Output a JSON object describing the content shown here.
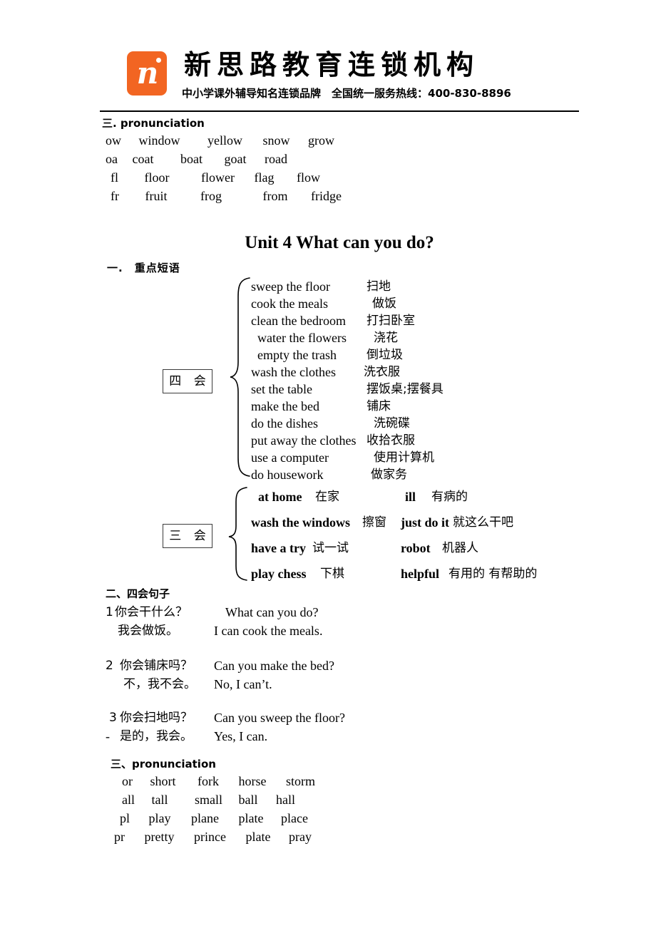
{
  "header": {
    "brand_title": "新思路教育连锁机构",
    "brand_sub": "中小学课外辅导知名连锁品牌　全国统一服务热线：400-830-8896",
    "logo_letter": "n",
    "logo_color": "#F26522"
  },
  "top_pronunciation": {
    "heading": "三. pronunciation",
    "rows": [
      {
        "key": "ow",
        "words": [
          "window",
          "yellow",
          "snow",
          "grow"
        ]
      },
      {
        "key": "oa",
        "words": [
          "coat",
          "boat",
          "goat",
          "road"
        ]
      },
      {
        "key": "fl",
        "words": [
          "floor",
          "flower",
          "flag",
          "flow"
        ]
      },
      {
        "key": "fr",
        "words": [
          "fruit",
          "frog",
          "from",
          "fridge"
        ]
      }
    ]
  },
  "unit": {
    "title": "Unit 4 What can you do?",
    "section_one_heading": "一.　重点短语"
  },
  "sihui": {
    "box_label": "四 会",
    "items": [
      {
        "en": "sweep the floor",
        "cn": "扫地"
      },
      {
        "en": "cook the meals",
        "cn": "做饭"
      },
      {
        "en": "clean the bedroom",
        "cn": "打扫卧室"
      },
      {
        "en": "water the flowers",
        "cn": "浇花"
      },
      {
        "en": "empty the trash",
        "cn": "倒垃圾"
      },
      {
        "en": "wash the clothes",
        "cn": "洗衣服"
      },
      {
        "en": "set the table",
        "cn": "摆饭桌;摆餐具"
      },
      {
        "en": "make the bed",
        "cn": "铺床"
      },
      {
        "en": "do the dishes",
        "cn": "洗碗碟"
      },
      {
        "en": "put away the clothes",
        "cn": "收拾衣服"
      },
      {
        "en": "use a computer",
        "cn": "使用计算机"
      },
      {
        "en": "do housework",
        "cn": "做家务"
      }
    ]
  },
  "sanhui": {
    "box_label": "三 会",
    "rows": [
      {
        "left_en": "at home",
        "left_cn": "在家",
        "right_en": "ill",
        "right_cn": "有病的"
      },
      {
        "left_en": "wash the windows",
        "left_cn": "擦窗",
        "right_en": "just do it",
        "right_cn": "就这么干吧"
      },
      {
        "left_en": "have a try",
        "left_cn": "试一试",
        "right_en": "robot",
        "right_cn": "机器人"
      },
      {
        "left_en": "play chess",
        "left_cn": "下棋",
        "right_en": "helpful",
        "right_cn": "有用的 有帮助的"
      }
    ]
  },
  "sentences": {
    "heading": "二、四会句子",
    "items": [
      {
        "num": "1",
        "q_cn": "你会干什么？",
        "q_en": "What can you do?",
        "a_cn": "我会做饭。",
        "a_en": "I can cook the meals."
      },
      {
        "num": "2",
        "q_cn": "你会铺床吗？",
        "q_en": "Can you make the bed?",
        "a_cn": "不，我不会。",
        "a_en": "No, I can’t."
      },
      {
        "num": "3",
        "q_cn": "你会扫地吗？",
        "q_en": "Can you sweep the floor?",
        "a_mark": "-",
        "a_cn": "是的，我会。",
        "a_en": "Yes, I can."
      }
    ]
  },
  "bottom_pronunciation": {
    "heading": "三、pronunciation",
    "rows": [
      {
        "key": "or",
        "words": [
          "short",
          "fork",
          "horse",
          "storm"
        ]
      },
      {
        "key": "all",
        "words": [
          "tall",
          "small",
          "ball",
          "hall"
        ]
      },
      {
        "key": "pl",
        "words": [
          "play",
          "plane",
          "plate",
          "place"
        ]
      },
      {
        "key": "pr",
        "words": [
          "pretty",
          "prince",
          "plate",
          "pray"
        ]
      }
    ]
  }
}
